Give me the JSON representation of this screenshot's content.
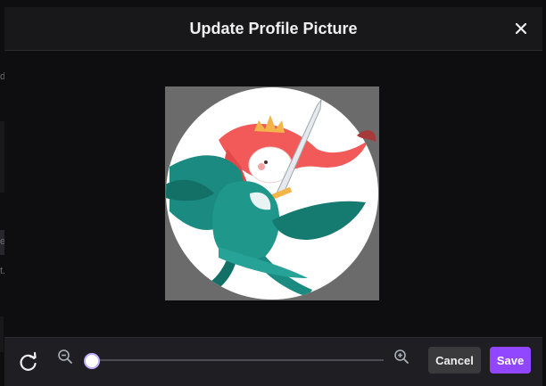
{
  "background": {
    "letters": [
      "d",
      "e",
      "t."
    ]
  },
  "modal": {
    "title": "Update Profile Picture",
    "close_icon": "close-icon"
  },
  "crop": {
    "image_description_icon": "profile-illustration",
    "mask": "circle"
  },
  "footer": {
    "rotate_icon": "rotate-icon",
    "zoom_out_icon": "zoom-out-icon",
    "zoom_in_icon": "zoom-in-icon",
    "zoom_level": 0,
    "cancel_label": "Cancel",
    "save_label": "Save"
  },
  "colors": {
    "accent": "#9147ff",
    "thumb_ring": "#bfabff",
    "header_bg": "#18181b",
    "footer_bg": "#1f1f23"
  }
}
